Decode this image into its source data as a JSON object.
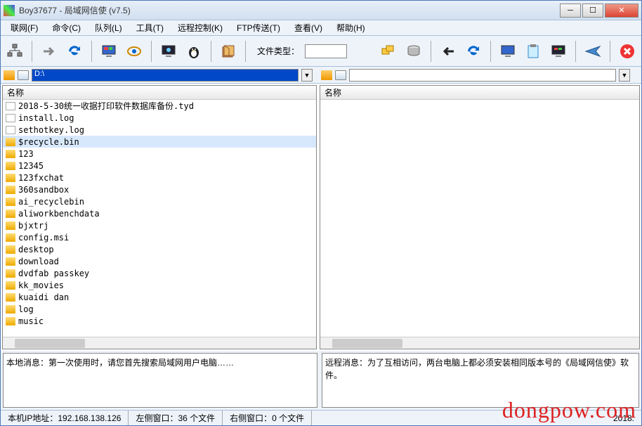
{
  "title": "Boy37677 - 局域网信使 (v7.5)",
  "menu": {
    "network": "联网(F)",
    "command": "命令(C)",
    "queue": "队列(L)",
    "tools": "工具(T)",
    "remote": "远程控制(K)",
    "ftp": "FTP传送(T)",
    "view": "查看(V)",
    "help": "帮助(H)"
  },
  "toolbar": {
    "file_type_label": "文件类型：",
    "file_type_value": ""
  },
  "path": {
    "left": "D:\\",
    "right": ""
  },
  "columns": {
    "name": "名称"
  },
  "files_left": [
    {
      "name": "2018-5-30统一收据打印软件数据库备份.tyd",
      "type": "file"
    },
    {
      "name": "install.log",
      "type": "file"
    },
    {
      "name": "sethotkey.log",
      "type": "file"
    },
    {
      "name": "$recycle.bin",
      "type": "folder",
      "selected": true
    },
    {
      "name": "123",
      "type": "folder"
    },
    {
      "name": "12345",
      "type": "folder"
    },
    {
      "name": "123fxchat",
      "type": "folder"
    },
    {
      "name": "360sandbox",
      "type": "folder"
    },
    {
      "name": "ai_recyclebin",
      "type": "folder"
    },
    {
      "name": "aliworkbenchdata",
      "type": "folder"
    },
    {
      "name": "bjxtrj",
      "type": "folder"
    },
    {
      "name": "config.msi",
      "type": "folder"
    },
    {
      "name": "desktop",
      "type": "folder"
    },
    {
      "name": "download",
      "type": "folder"
    },
    {
      "name": "dvdfab passkey",
      "type": "folder"
    },
    {
      "name": "kk_movies",
      "type": "folder"
    },
    {
      "name": "kuaidi dan",
      "type": "folder"
    },
    {
      "name": "log",
      "type": "folder"
    },
    {
      "name": "music",
      "type": "folder"
    }
  ],
  "files_right": [],
  "messages": {
    "left": "本地消息：第一次使用时，请您首先搜索局域网用户电脑……",
    "right": "远程消息：为了互相访问，两台电脑上都必须安装相同版本号的《局域网信使》软件。"
  },
  "status": {
    "ip_label": "本机IP地址：",
    "ip": "192.168.138.126",
    "left_window": "左侧窗口：36 个文件",
    "right_window": "右侧窗口：0 个文件",
    "date": "2018."
  },
  "watermark": "dongpow.com"
}
